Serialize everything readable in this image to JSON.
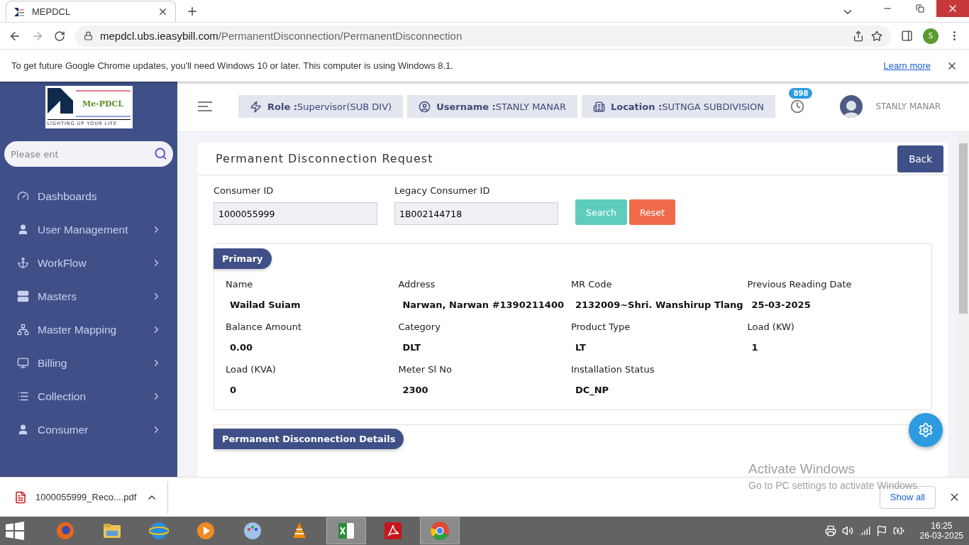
{
  "browser": {
    "tab_title": "MEPDCL",
    "url_host": "mepdcl.ubs.ieasybill.com",
    "url_path": "/PermanentDisconnection/PermanentDisconnection",
    "profile_initial": "S"
  },
  "infobar": {
    "message": "To get future Google Chrome updates, you'll need Windows 10 or later. This computer is using Windows 8.1.",
    "link": "Learn more"
  },
  "logo": {
    "name": "Me-PDCL",
    "tagline": "LIGHTING UP YOUR LIFE"
  },
  "sidebar": {
    "search_placeholder": "Please ent",
    "items": [
      {
        "label": "Dashboards",
        "kind": "link"
      },
      {
        "label": "User Management",
        "kind": "submenu"
      },
      {
        "label": "WorkFlow",
        "kind": "submenu"
      },
      {
        "label": "Masters",
        "kind": "submenu"
      },
      {
        "label": "Master Mapping",
        "kind": "submenu"
      },
      {
        "label": "Billing",
        "kind": "submenu"
      },
      {
        "label": "Collection",
        "kind": "submenu"
      },
      {
        "label": "Consumer",
        "kind": "submenu"
      }
    ]
  },
  "header": {
    "chips": [
      {
        "kind": "role",
        "label": "Role :",
        "value": "Supervisor(SUB DIV)"
      },
      {
        "kind": "username",
        "label": "Username :",
        "value": "STANLY MANAR"
      },
      {
        "kind": "location",
        "label": "Location :",
        "value": "SUTNGA SUBDIVISION"
      }
    ],
    "notification_count": "898",
    "user_name": "STANLY MANAR"
  },
  "page": {
    "title": "Permanent Disconnection Request",
    "back_button": "Back",
    "fields": [
      {
        "label": "Consumer ID",
        "value": "1000055999"
      },
      {
        "label": "Legacy Consumer ID",
        "value": "1B002144718"
      }
    ],
    "search_button": "Search",
    "reset_button": "Reset",
    "primary": {
      "heading": "Primary",
      "items": [
        {
          "label": "Name",
          "value": "Wailad Suiam"
        },
        {
          "label": "Address",
          "value": "Narwan, Narwan #1390211400"
        },
        {
          "label": "MR Code",
          "value": "2132009~Shri. Wanshirup Tlang"
        },
        {
          "label": "Previous Reading Date",
          "value": "25-03-2025"
        },
        {
          "label": "Balance Amount",
          "value": "0.00"
        },
        {
          "label": "Category",
          "value": "DLT"
        },
        {
          "label": "Product Type",
          "value": "LT"
        },
        {
          "label": "Load (KW)",
          "value": "1"
        },
        {
          "label": "Load (KVA)",
          "value": "0"
        },
        {
          "label": "Meter Sl No",
          "value": "2300"
        },
        {
          "label": "Installation Status",
          "value": "DC_NP"
        }
      ]
    },
    "details_heading": "Permanent Disconnection Details"
  },
  "downloads": {
    "file": "1000055999_Reco....pdf",
    "show_all": "Show all"
  },
  "os_notice": {
    "title": "Activate Windows",
    "message": "Go to PC settings to activate Windows."
  },
  "taskbar": {
    "apps": [
      {
        "selected": false
      },
      {
        "selected": false
      },
      {
        "selected": false
      },
      {
        "selected": false
      },
      {
        "selected": false
      },
      {
        "selected": false
      },
      {
        "selected": true
      },
      {
        "selected": false
      },
      {
        "selected": true
      }
    ],
    "time": "16:25",
    "date": "26-03-2025"
  }
}
